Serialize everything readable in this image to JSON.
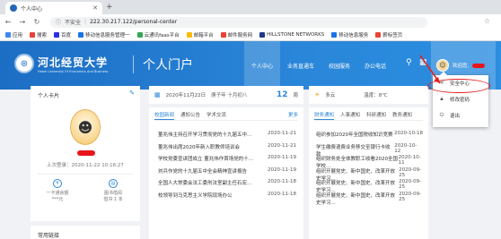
{
  "browser": {
    "tab_title": "个人中心",
    "new_tab": "+",
    "insecure": "不安全",
    "url": "222.30.217.122/personal-center",
    "bookmarks": [
      {
        "label": "应用",
        "color": "#4285f4"
      },
      {
        "label": "搜索",
        "color": "#e94235"
      },
      {
        "label": "百度",
        "color": "#2932e1"
      },
      {
        "label": "移动信息服务管理一",
        "color": "#1a73e8"
      },
      {
        "label": "云通讯faas平台",
        "color": "#34a853"
      },
      {
        "label": "邮箱平台",
        "color": "#fbbc05"
      },
      {
        "label": "邮件服务网",
        "color": "#ea4335"
      },
      {
        "label": "HILLSTONE NETWORKS",
        "color": "#1e3a8a"
      },
      {
        "label": "移动信息服务",
        "color": "#1a73e8"
      },
      {
        "label": "薪标签页",
        "color": "#ea4335"
      }
    ]
  },
  "header": {
    "logo_cn": "河北经贸大学",
    "logo_en": "Hebei University Of Economics And Business",
    "portal_title": "个人门户",
    "nav": [
      "个人中心",
      "业务直通车",
      "校园服务",
      "办公电话"
    ],
    "welcome": "欢迎您,"
  },
  "dropdown": {
    "items": [
      {
        "label": "安全中心",
        "icon": "shield-icon"
      },
      {
        "label": "修改密码",
        "icon": "lock-icon"
      },
      {
        "label": "退出",
        "icon": "logout-icon"
      }
    ]
  },
  "profile": {
    "title": "个人卡片",
    "last_login": "上次登录：2020-11-22 10:16:27",
    "mini": [
      {
        "label": "一卡通余额",
        "value": "***元"
      },
      {
        "label": "图书借阅",
        "value": "借书 1 本"
      }
    ]
  },
  "quick_links": {
    "title": "常用链接"
  },
  "date_bar": {
    "date": "2020年11月22日",
    "lunar": "庚子年 十月初八",
    "week_number": "12",
    "week_unit": "周"
  },
  "weather": {
    "condition": "多云",
    "temp": "温度：8℃"
  },
  "news_left": {
    "tabs": [
      "校园新闻",
      "通知公告",
      "学术交流"
    ],
    "more": "更多",
    "rows": [
      {
        "title": "董兆伟主持召开学习贯彻党的十九届五中...",
        "date": "2020-11-21"
      },
      {
        "title": "董兆伟出席2020年新入职教师培训会",
        "date": "2020-11-21"
      },
      {
        "title": "学校党委宣讲团成立 董兆伟作首场党的十...",
        "date": "2020-11-19"
      },
      {
        "title": "刘兵作党的十九届五中全会精神宣讲报告",
        "date": "2020-11-19"
      },
      {
        "title": "全国人大常委会法工委刑法室副主任石宏...",
        "date": "2020-11-18"
      },
      {
        "title": "校领导到马克思主义学院现场办公",
        "date": "2020-11-18"
      }
    ]
  },
  "news_right": {
    "tabs": [
      "财务通知",
      "人事通知",
      "科研通知",
      "教务通知"
    ],
    "more": "更多",
    "rows": [
      {
        "title": "组织参加2020年全国税收知识竞赛",
        "date": "2020-10-18"
      },
      {
        "title": "学生缴费退费业务移交至银行卡收款",
        "date": "2020-10-12"
      },
      {
        "title": "组织财务处全体教职工收看2020全国学校...",
        "date": "2020-10-11"
      },
      {
        "title": "组织开展党史、新中国史、改革开放史学习...",
        "date": "2020-09-25"
      },
      {
        "title": "组织开展党史、新中国史、改革开放史学习...",
        "date": "2020-09-25"
      },
      {
        "title": "组织开展党史、新中国史、改革开放史学习...",
        "date": "2020-09-25"
      }
    ]
  }
}
